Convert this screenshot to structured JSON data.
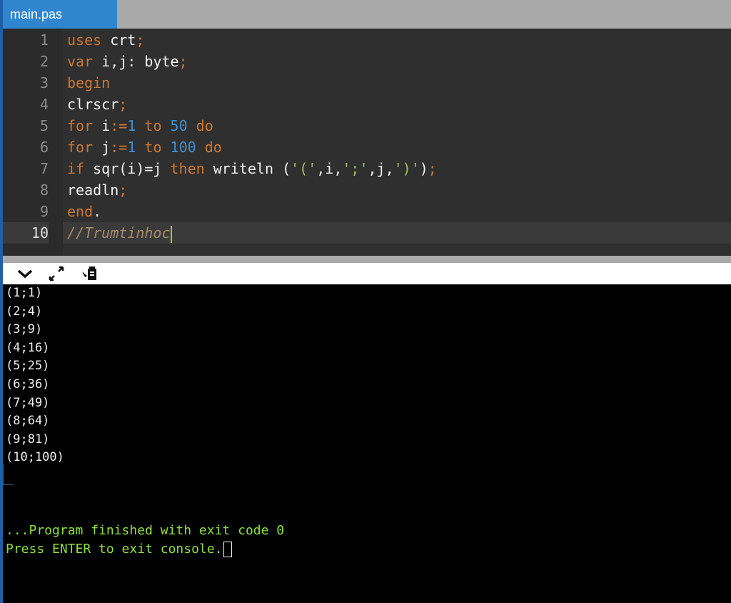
{
  "tab": {
    "label": "main.pas"
  },
  "editor": {
    "line_numbers": [
      "1",
      "2",
      "3",
      "4",
      "5",
      "6",
      "7",
      "8",
      "9",
      "10"
    ],
    "lines": [
      [
        {
          "t": "uses",
          "c": "kw"
        },
        {
          "t": " crt",
          "c": "id"
        },
        {
          "t": ";",
          "c": "pn"
        }
      ],
      [
        {
          "t": "var",
          "c": "kw"
        },
        {
          "t": " i,j: byte",
          "c": "id"
        },
        {
          "t": ";",
          "c": "pn"
        }
      ],
      [
        {
          "t": "begin",
          "c": "kw"
        }
      ],
      [
        {
          "t": "clrscr",
          "c": "id"
        },
        {
          "t": ";",
          "c": "pn"
        }
      ],
      [
        {
          "t": "for",
          "c": "kw"
        },
        {
          "t": " i",
          "c": "id"
        },
        {
          "t": ":=",
          "c": "pn"
        },
        {
          "t": "1",
          "c": "num"
        },
        {
          "t": " to",
          "c": "kw"
        },
        {
          "t": " 50",
          "c": "num"
        },
        {
          "t": " do",
          "c": "kw"
        }
      ],
      [
        {
          "t": "for",
          "c": "kw"
        },
        {
          "t": " j",
          "c": "id"
        },
        {
          "t": ":=",
          "c": "pn"
        },
        {
          "t": "1",
          "c": "num"
        },
        {
          "t": " to",
          "c": "kw"
        },
        {
          "t": " 100",
          "c": "num"
        },
        {
          "t": " do",
          "c": "kw"
        }
      ],
      [
        {
          "t": "if",
          "c": "kw"
        },
        {
          "t": " sqr(i)=j",
          "c": "id"
        },
        {
          "t": " then",
          "c": "kw"
        },
        {
          "t": " writeln (",
          "c": "id"
        },
        {
          "t": "'('",
          "c": "str"
        },
        {
          "t": ",i,",
          "c": "id"
        },
        {
          "t": "';'",
          "c": "str"
        },
        {
          "t": ",j,",
          "c": "id"
        },
        {
          "t": "')'",
          "c": "str"
        },
        {
          "t": ")",
          "c": "id"
        },
        {
          "t": ";",
          "c": "pn"
        }
      ],
      [
        {
          "t": "readln",
          "c": "id"
        },
        {
          "t": ";",
          "c": "pn"
        }
      ],
      [
        {
          "t": "end",
          "c": "kw"
        },
        {
          "t": ".",
          "c": "id"
        }
      ],
      [
        {
          "t": "//Trumtinhoc",
          "c": "cm"
        }
      ]
    ]
  },
  "toolbar": {
    "collapse_icon": "chevron-down-icon",
    "expand_icon": "expand-icon",
    "stop_icon": "stop-icon"
  },
  "console": {
    "output": [
      "(1;1)",
      "(2;4)",
      "(3;9)",
      "(4;16)",
      "(5;25)",
      "(6;36)",
      "(7;49)",
      "(8;64)",
      "(9;81)",
      "(10;100)"
    ],
    "finished_msg": "...Program finished with exit code 0",
    "press_msg": "Press ENTER to exit console."
  },
  "colors": {
    "keyword": "#cc7832",
    "number": "#3f8fd0",
    "string": "#a5c25c",
    "comment": "#a88a6a",
    "console_green": "#8ce23a",
    "tab_active": "#2f86cf"
  }
}
